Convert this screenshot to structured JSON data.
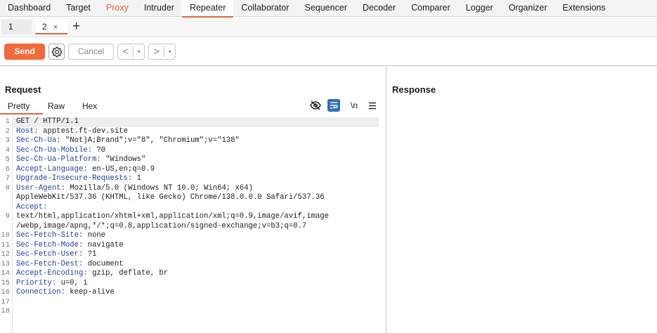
{
  "top_tabs": [
    "Dashboard",
    "Target",
    "Proxy",
    "Intruder",
    "Repeater",
    "Collaborator",
    "Sequencer",
    "Decoder",
    "Comparer",
    "Logger",
    "Organizer",
    "Extensions"
  ],
  "repeater_tabs": [
    {
      "label": "1"
    },
    {
      "label": "2",
      "close": "×"
    }
  ],
  "add_tab": "+",
  "toolbar": {
    "send": "Send",
    "cancel": "Cancel",
    "back": "<",
    "forward": ">",
    "caret": "▾"
  },
  "request": {
    "title": "Request",
    "view_tabs": [
      "Pretty",
      "Raw",
      "Hex"
    ],
    "newline_toggle": "\\n",
    "lines": [
      {
        "n": "1",
        "key": "",
        "val": "GET / HTTP/1.1"
      },
      {
        "n": "2",
        "key": "Host:",
        "val": " apptest.ft-dev.site"
      },
      {
        "n": "3",
        "key": "Sec-Ch-Ua:",
        "val": " \"Not)A;Brand\";v=\"8\", \"Chromium\";v=\"138\""
      },
      {
        "n": "4",
        "key": "Sec-Ch-Ua-Mobile:",
        "val": " ?0"
      },
      {
        "n": "5",
        "key": "Sec-Ch-Ua-Platform:",
        "val": " \"Windows\""
      },
      {
        "n": "6",
        "key": "Accept-Language:",
        "val": " en-US,en;q=0.9"
      },
      {
        "n": "7",
        "key": "Upgrade-Insecure-Requests:",
        "val": " 1"
      },
      {
        "n": "8",
        "key": "User-Agent:",
        "val": " Mozilla/5.0 (Windows NT 10.0; Win64; x64)"
      },
      {
        "n": "",
        "key": "",
        "val": "AppleWebKit/537.36 (KHTML, like Gecko) Chrome/138.0.0.0 Safari/537.36"
      },
      {
        "n": "",
        "key": "Accept:",
        "val": ""
      },
      {
        "n": "9",
        "key": "",
        "val": "text/html,application/xhtml+xml,application/xml;q=0.9,image/avif,image"
      },
      {
        "n": "",
        "key": "",
        "val": "/webp,image/apng,*/*;q=0.8,application/signed-exchange;v=b3;q=0.7"
      },
      {
        "n": "10",
        "key": "Sec-Fetch-Site:",
        "val": " none"
      },
      {
        "n": "11",
        "key": "Sec-Fetch-Mode:",
        "val": " navigate"
      },
      {
        "n": "12",
        "key": "Sec-Fetch-User:",
        "val": " ?1"
      },
      {
        "n": "13",
        "key": "Sec-Fetch-Dest:",
        "val": " document"
      },
      {
        "n": "14",
        "key": "Accept-Encoding:",
        "val": " gzip, deflate, br"
      },
      {
        "n": "15",
        "key": "Priority:",
        "val": " u=0, i"
      },
      {
        "n": "16",
        "key": "Connection:",
        "val": " keep-alive"
      },
      {
        "n": "17",
        "key": "",
        "val": ""
      },
      {
        "n": "18",
        "key": "",
        "val": ""
      }
    ]
  },
  "response": {
    "title": "Response"
  },
  "colors": {
    "accent": "#e8643a",
    "send": "#f26b3a",
    "header_key": "#1f3fa6",
    "wrap_active": "#2f6fbf"
  }
}
